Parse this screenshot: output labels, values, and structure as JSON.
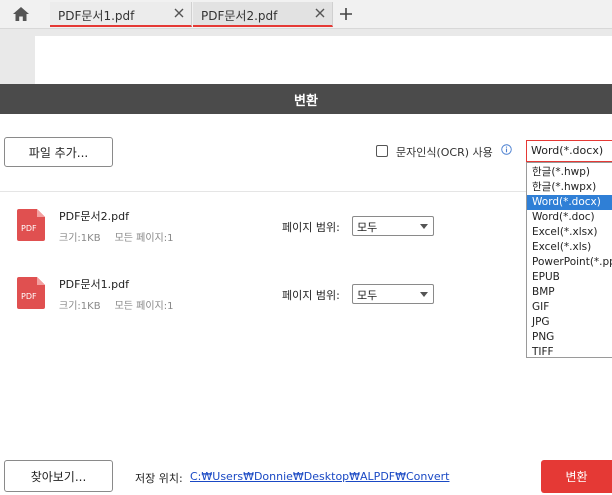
{
  "tabs": [
    {
      "label": "PDF문서1.pdf",
      "active": false
    },
    {
      "label": "PDF문서2.pdf",
      "active": true
    }
  ],
  "dialog": {
    "title": "변환",
    "add_file_label": "파일 추가...",
    "ocr_label": "문자인식(OCR) 사용",
    "ocr_checked": false,
    "format_selected": "Word(*.docx)",
    "format_options": [
      "한글(*.hwp)",
      "한글(*.hwpx)",
      "Word(*.docx)",
      "Word(*.doc)",
      "Excel(*.xlsx)",
      "Excel(*.xls)",
      "PowerPoint(*.pptx)",
      "EPUB",
      "BMP",
      "GIF",
      "JPG",
      "PNG",
      "TIFF"
    ],
    "files": [
      {
        "name": "PDF문서2.pdf",
        "size": "크기:1KB",
        "pages": "모든 페이지:1",
        "range_label": "페이지 범위:",
        "range_value": "모두"
      },
      {
        "name": "PDF문서1.pdf",
        "size": "크기:1KB",
        "pages": "모든 페이지:1",
        "range_label": "페이지 범위:",
        "range_value": "모두"
      }
    ],
    "browse_label": "찾아보기...",
    "save_label": "저장 위치:",
    "save_path": "C:₩Users₩Donnie₩Desktop₩ALPDF₩Convert",
    "convert_label": "변환"
  },
  "colors": {
    "accent": "#e53935",
    "header_bg": "#4b4b4b",
    "selected_bg": "#2f7fd6",
    "link": "#1a49c4"
  }
}
